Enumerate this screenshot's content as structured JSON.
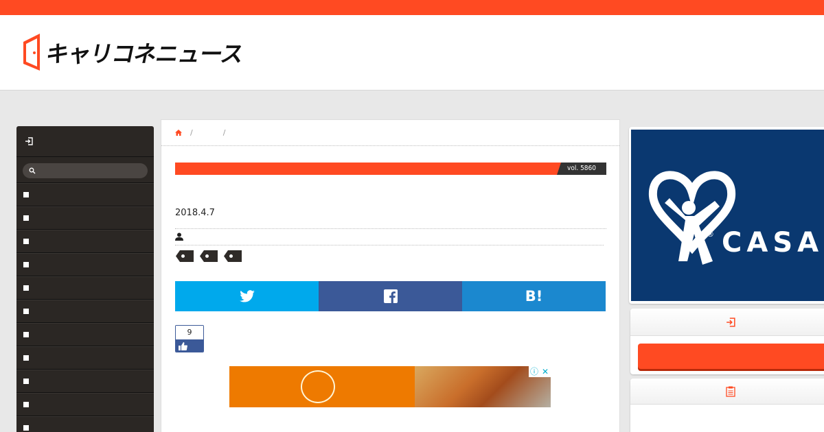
{
  "site": {
    "name": "キャリコネニュース",
    "accent_color": "#ff4a22"
  },
  "sidebar": {
    "login_icon": "login-icon",
    "search": {
      "placeholder": "",
      "icon": "search-icon"
    },
    "items_count_visible": 11
  },
  "article": {
    "breadcrumb": {
      "home_icon": "home-icon",
      "separators": [
        "/",
        "/"
      ]
    },
    "vol_label": "vol. 5860",
    "date": "2018.4.7",
    "author_icon": "user-icon",
    "tags_count": 3,
    "share": {
      "twitter_icon": "twitter-icon",
      "facebook_icon": "facebook-icon",
      "hatena_label": "B!"
    },
    "like": {
      "count": "9",
      "icon": "thumbs-up-icon"
    }
  },
  "ad": {
    "info_label": "ⓘ",
    "close_label": "✕"
  },
  "right_banner": {
    "brand_text": "CASA",
    "registered": "®"
  },
  "right_boxes": [
    {
      "icon": "login-icon"
    },
    {
      "icon": "clipboard-icon"
    }
  ]
}
